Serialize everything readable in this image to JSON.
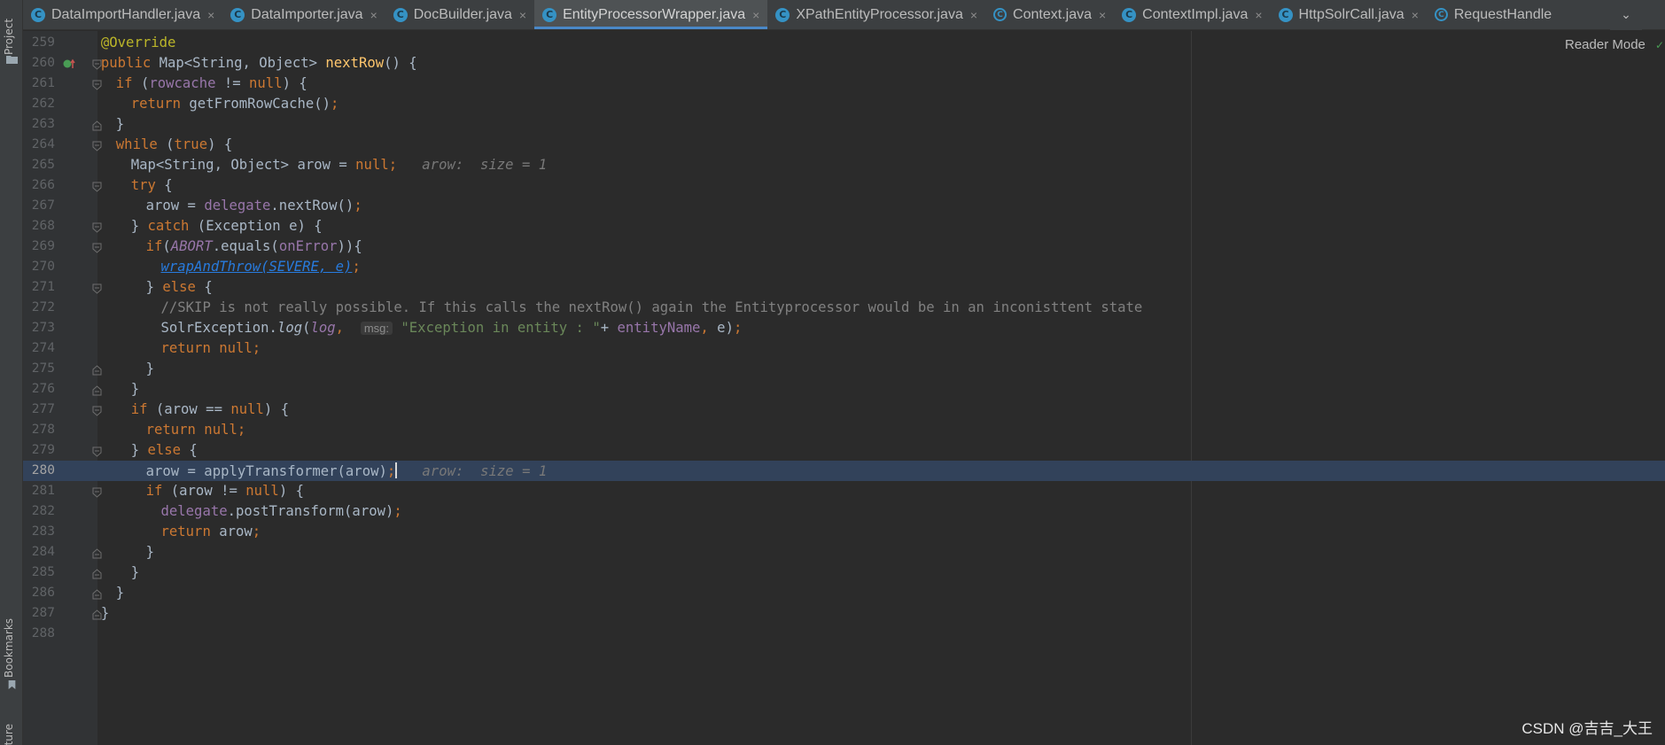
{
  "left_toolstrip": {
    "project_label": "Project",
    "bookmarks_label": "Bookmarks",
    "structure_label": "cture"
  },
  "tabs": [
    {
      "label": "DataImportHandler.java",
      "icon": "class-icon",
      "active": false
    },
    {
      "label": "DataImporter.java",
      "icon": "class-icon",
      "active": false
    },
    {
      "label": "DocBuilder.java",
      "icon": "class-icon",
      "active": false
    },
    {
      "label": "EntityProcessorWrapper.java",
      "icon": "class-icon",
      "active": true
    },
    {
      "label": "XPathEntityProcessor.java",
      "icon": "class-icon",
      "active": false
    },
    {
      "label": "Context.java",
      "icon": "abstract-class-icon",
      "active": false
    },
    {
      "label": "ContextImpl.java",
      "icon": "class-icon",
      "active": false
    },
    {
      "label": "HttpSolrCall.java",
      "icon": "class-icon",
      "active": false
    },
    {
      "label": "RequestHandle",
      "icon": "abstract-class-icon",
      "active": false
    }
  ],
  "editor": {
    "reader_mode_label": "Reader Mode",
    "current_line": 280,
    "lines": [
      {
        "n": "259",
        "html": "<span class=\"ann\">@Override</span>",
        "indent": 1
      },
      {
        "n": "260",
        "html": "<span class=\"kw\">public</span> Map&lt;String, Object&gt; <span class=\"fn\">nextRow</span>() {",
        "indent": 1
      },
      {
        "n": "261",
        "html": "<span class=\"kw\">if</span> (<span class=\"fld\">rowcache</span> != <span class=\"kw\">null</span>) {",
        "indent": 2
      },
      {
        "n": "262",
        "html": "<span class=\"kw\">return</span> getFromRowCache()<span class=\"kw\">;</span>",
        "indent": 3
      },
      {
        "n": "263",
        "html": "}",
        "indent": 2
      },
      {
        "n": "264",
        "html": "<span class=\"kw\">while</span> (<span class=\"kw\">true</span>) {",
        "indent": 2
      },
      {
        "n": "265",
        "html": "Map&lt;String, Object&gt; arow = <span class=\"kw\">null;</span>   <span class=\"hint\">arow:  size = 1</span>",
        "indent": 3
      },
      {
        "n": "266",
        "html": "<span class=\"kw\">try</span> {",
        "indent": 3
      },
      {
        "n": "267",
        "html": "arow = <span class=\"fld\">delegate</span>.nextRow()<span class=\"kw\">;</span>",
        "indent": 4
      },
      {
        "n": "268",
        "html": "} <span class=\"kw\">catch</span> (Exception e) {",
        "indent": 3
      },
      {
        "n": "269",
        "html": "<span class=\"kw\">if</span>(<span class=\"fldi\">ABORT</span>.equals(<span class=\"fld\">onError</span>)){",
        "indent": 4
      },
      {
        "n": "270",
        "html": "<span class=\"link\">wrapAndThrow(SEVERE, e)</span><span class=\"kw\">;</span>",
        "indent": 5
      },
      {
        "n": "271",
        "html": "} <span class=\"kw\">else</span> {",
        "indent": 4
      },
      {
        "n": "272",
        "html": "<span class=\"cmt\">//SKIP is not really possible. If this calls the nextRow() again the Entityprocessor would be in an inconisttent state</span>",
        "indent": 5
      },
      {
        "n": "273",
        "html": "SolrException.<span class=\"stat\">log</span>(<span class=\"fldi\">log</span><span class=\"kw\">,</span>  <span class=\"param-hint\">msg:</span> <span class=\"str\">\"Exception in entity : \"</span>+ <span class=\"fld\">entityName</span><span class=\"kw\">,</span> e)<span class=\"kw\">;</span>",
        "indent": 5
      },
      {
        "n": "274",
        "html": "<span class=\"kw\">return null;</span>",
        "indent": 5
      },
      {
        "n": "275",
        "html": "}",
        "indent": 4
      },
      {
        "n": "276",
        "html": "}",
        "indent": 3
      },
      {
        "n": "277",
        "html": "<span class=\"kw\">if</span> (arow == <span class=\"kw\">null</span>) {",
        "indent": 3
      },
      {
        "n": "278",
        "html": "<span class=\"kw\">return null;</span>",
        "indent": 4
      },
      {
        "n": "279",
        "html": "} <span class=\"kw\">else</span> {",
        "indent": 3
      },
      {
        "n": "280",
        "html": "arow = applyTransformer(arow)<span class=\"kw\">;</span><span class=\"caret\"></span>   <span class=\"hint\">arow:  size = 1</span>",
        "indent": 4
      },
      {
        "n": "281",
        "html": "<span class=\"kw\">if</span> (arow != <span class=\"kw\">null</span>) {",
        "indent": 4
      },
      {
        "n": "282",
        "html": "<span class=\"fld\">delegate</span>.postTransform(arow)<span class=\"kw\">;</span>",
        "indent": 5
      },
      {
        "n": "283",
        "html": "<span class=\"kw\">return</span> arow<span class=\"kw\">;</span>",
        "indent": 5
      },
      {
        "n": "284",
        "html": "}",
        "indent": 4
      },
      {
        "n": "285",
        "html": "}",
        "indent": 3
      },
      {
        "n": "286",
        "html": "}",
        "indent": 2
      },
      {
        "n": "287",
        "html": "}",
        "indent": 1
      },
      {
        "n": "288",
        "html": "",
        "indent": 0
      }
    ]
  },
  "watermark": "CSDN @吉吉_大王"
}
